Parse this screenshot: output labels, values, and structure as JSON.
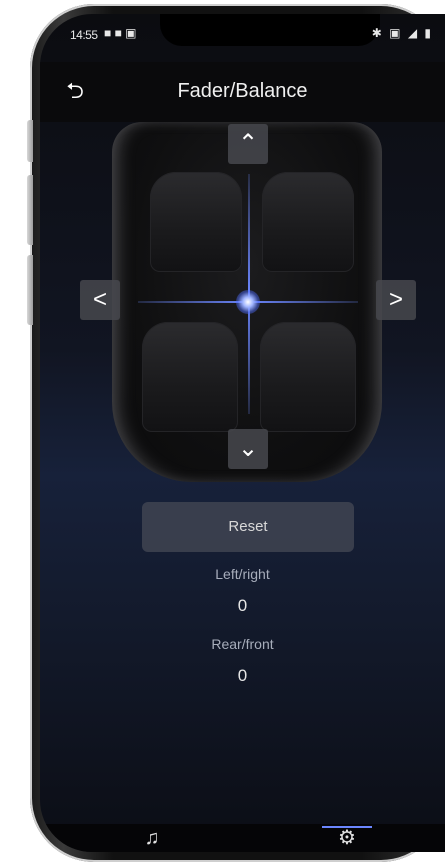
{
  "status_bar": {
    "time": "14:55",
    "left_icons": "■ ■ ▣",
    "right_icons": "✱ ▣ ◢ ▮"
  },
  "header": {
    "title": "Fader/Balance",
    "back_glyph": "⮌"
  },
  "controls": {
    "up_glyph": "⌃",
    "down_glyph": "⌄",
    "left_glyph": "<",
    "right_glyph": ">"
  },
  "reset_label": "Reset",
  "left_right": {
    "label": "Left/right",
    "value": "0"
  },
  "rear_front": {
    "label": "Rear/front",
    "value": "0"
  },
  "tabs": [
    {
      "icon": "music-note-icon",
      "glyph": "♫"
    },
    {
      "icon": "gear-icon",
      "glyph": "⚙"
    }
  ],
  "colors": {
    "accent": "#6b86ff"
  }
}
